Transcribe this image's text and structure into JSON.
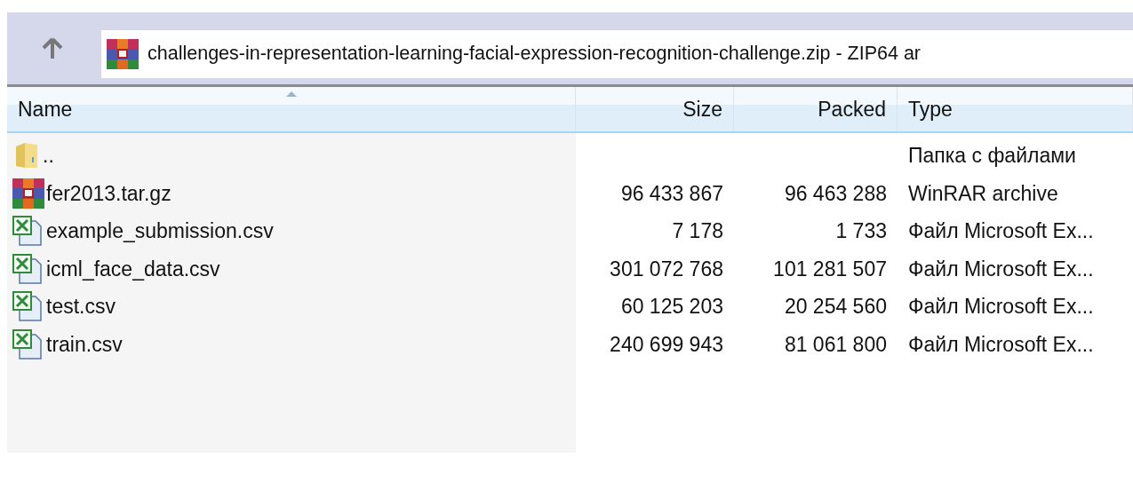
{
  "address": {
    "text": "challenges-in-representation-learning-facial-expression-recognition-challenge.zip - ZIP64 ar"
  },
  "columns": [
    {
      "label": "Name",
      "sorted": true
    },
    {
      "label": "Size",
      "sorted": false
    },
    {
      "label": "Packed",
      "sorted": false
    },
    {
      "label": "Type",
      "sorted": false
    }
  ],
  "rows": [
    {
      "kind": "folder",
      "name": "..",
      "size": "",
      "packed": "",
      "type": "Папка с файлами"
    },
    {
      "kind": "archive",
      "name": "fer2013.tar.gz",
      "size": "96 433 867",
      "packed": "96 463 288",
      "type": "WinRAR archive"
    },
    {
      "kind": "excel",
      "name": "example_submission.csv",
      "size": "7 178",
      "packed": "1 733",
      "type": "Файл Microsoft Ex..."
    },
    {
      "kind": "excel",
      "name": "icml_face_data.csv",
      "size": "301 072 768",
      "packed": "101 281 507",
      "type": "Файл Microsoft Ex..."
    },
    {
      "kind": "excel",
      "name": "test.csv",
      "size": "60 125 203",
      "packed": "20 254 560",
      "type": "Файл Microsoft Ex..."
    },
    {
      "kind": "excel",
      "name": "train.csv",
      "size": "240 699 943",
      "packed": "81 061 800",
      "type": "Файл Microsoft Ex..."
    }
  ]
}
